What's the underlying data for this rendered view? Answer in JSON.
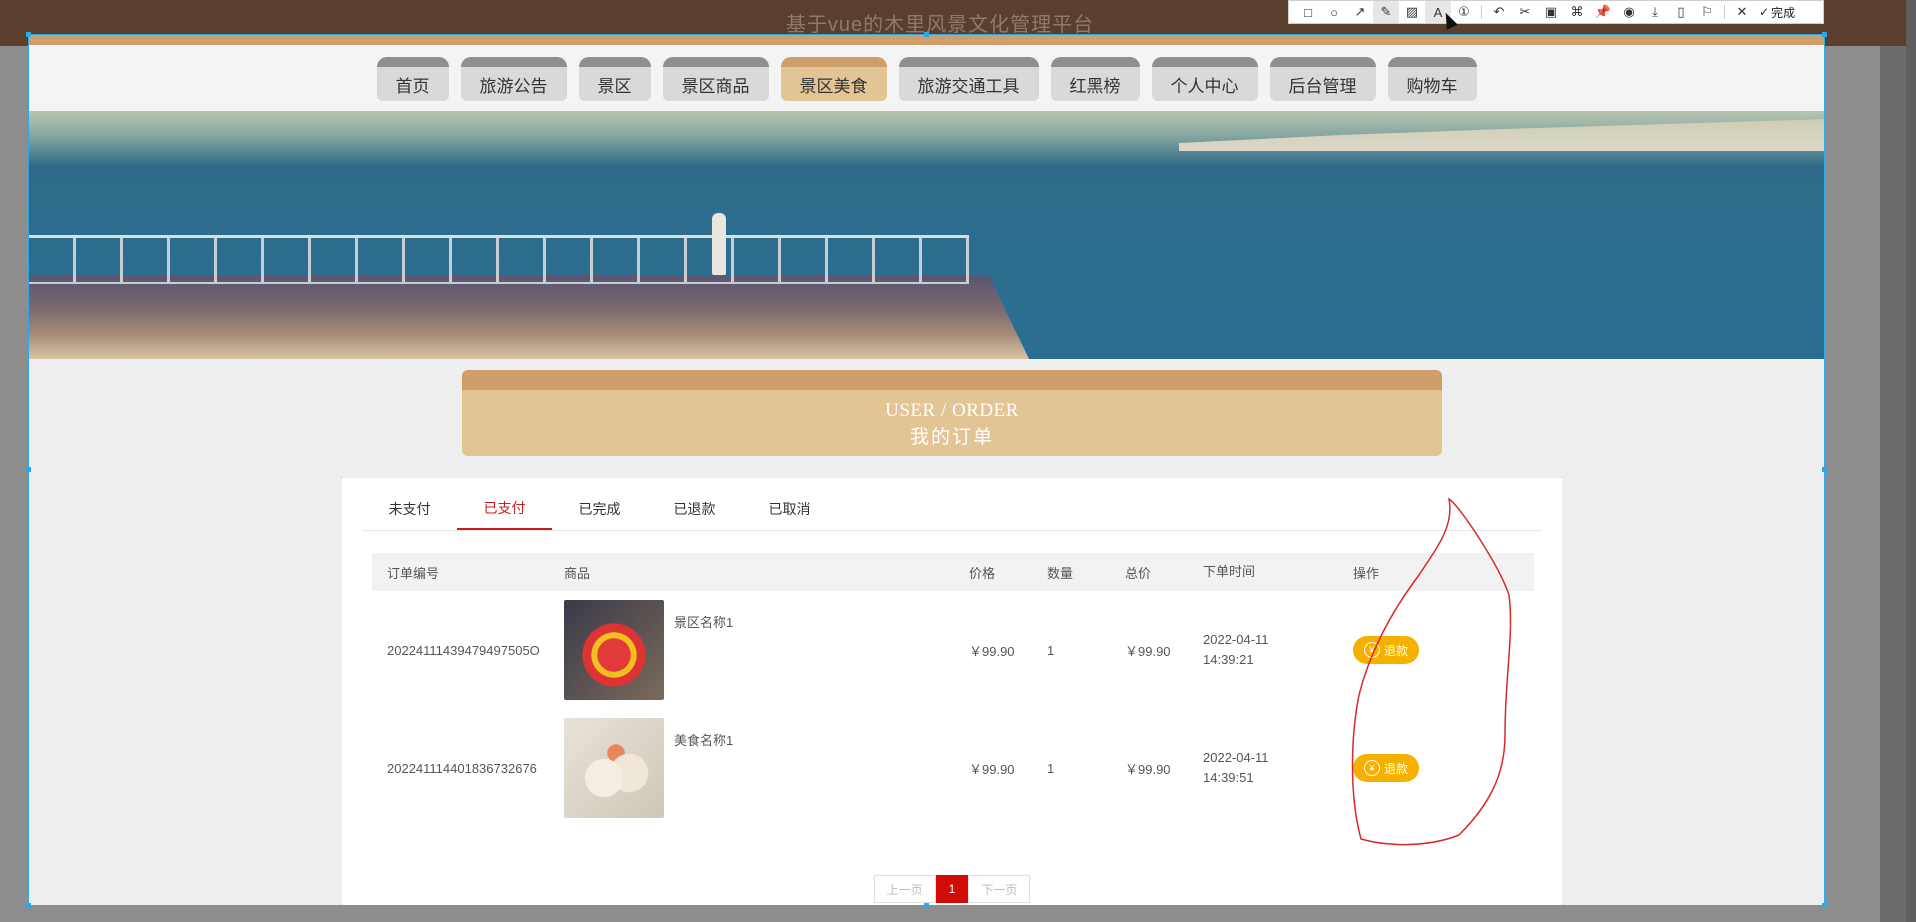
{
  "site": {
    "title": "基于vue的木里风景文化管理平台"
  },
  "nav": {
    "items": [
      {
        "label": "首页"
      },
      {
        "label": "旅游公告"
      },
      {
        "label": "景区"
      },
      {
        "label": "景区商品"
      },
      {
        "label": "景区美食",
        "active": true
      },
      {
        "label": "旅游交通工具"
      },
      {
        "label": "红黑榜"
      },
      {
        "label": "个人中心"
      },
      {
        "label": "后台管理"
      },
      {
        "label": "购物车"
      }
    ]
  },
  "order_header": {
    "en": "USER / ORDER",
    "cn": "我的订单"
  },
  "tabs": [
    {
      "label": "未支付"
    },
    {
      "label": "已支付",
      "active": true
    },
    {
      "label": "已完成"
    },
    {
      "label": "已退款"
    },
    {
      "label": "已取消"
    }
  ],
  "table": {
    "headers": {
      "id": "订单编号",
      "goods": "商品",
      "price": "价格",
      "qty": "数量",
      "total": "总价",
      "time": "下单时间",
      "op": "操作"
    },
    "rows": [
      {
        "id": "20224111439479497505O",
        "goods": "景区名称1",
        "price": "￥99.90",
        "qty": "1",
        "total": "￥99.90",
        "date": "2022-04-11",
        "time": "14:39:21",
        "action": "退款",
        "thumb_icon": "toy-image"
      },
      {
        "id": "202241114401836732676",
        "goods": "美食名称1",
        "price": "￥99.90",
        "qty": "1",
        "total": "￥99.90",
        "date": "2022-04-11",
        "time": "14:39:51",
        "action": "退款",
        "thumb_icon": "food-image"
      }
    ]
  },
  "pager": {
    "prev": "上一页",
    "current": "1",
    "next": "下一页"
  },
  "toolbar": {
    "done_label": "完成"
  },
  "colors": {
    "accent": "#cf9f6b",
    "accent_light": "#e3c494",
    "active_tab": "#c41f1f",
    "refund": "#f5b000",
    "pager_current": "#d10a0a",
    "selection": "#2ea6e8"
  }
}
